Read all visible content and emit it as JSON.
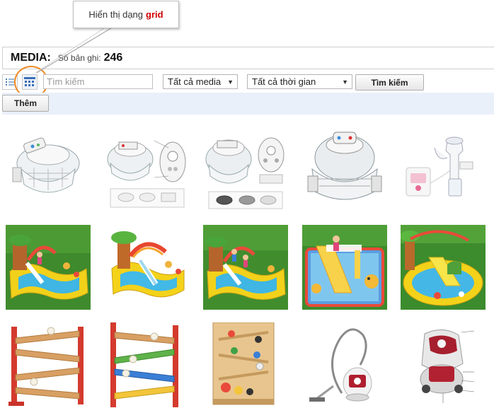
{
  "callout": {
    "prefix": "Hiển thị dạng",
    "highlight": "grid"
  },
  "header": {
    "title": "MEDIA:",
    "count_label": "Số bản ghi:",
    "count": "246"
  },
  "toolbar": {
    "list_view_icon": "list-view-icon",
    "grid_view_icon": "grid-view-icon",
    "search_placeholder": "Tìm kiếm",
    "media_filter": "Tất cả media",
    "time_filter": "Tất cả thời gian",
    "search_button": "Tìm kiếm",
    "add_button": "Thêm"
  },
  "media_items": [
    {
      "kind": "halogen-oven-open"
    },
    {
      "kind": "halogen-oven-diagram"
    },
    {
      "kind": "halogen-oven-diagram-2"
    },
    {
      "kind": "halogen-oven-closed"
    },
    {
      "kind": "breast-pump"
    },
    {
      "kind": "inflatable-pool-tree"
    },
    {
      "kind": "inflatable-pool-white-bg"
    },
    {
      "kind": "inflatable-pool-tree-2"
    },
    {
      "kind": "winnie-pool-slide"
    },
    {
      "kind": "inflatable-pool-slide"
    },
    {
      "kind": "wooden-ball-ramp-red"
    },
    {
      "kind": "wooden-ball-ramp-color"
    },
    {
      "kind": "wooden-marble-board"
    },
    {
      "kind": "vacuum-cleaner-white"
    },
    {
      "kind": "vacuum-cleaner-diagram"
    }
  ]
}
